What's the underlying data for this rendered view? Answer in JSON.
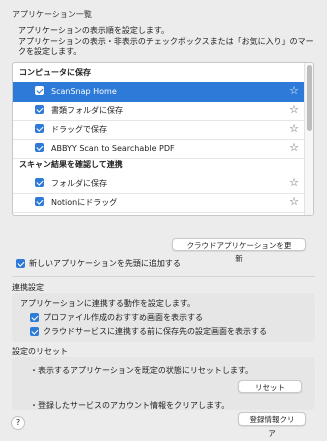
{
  "app_list": {
    "title": "アプリケーション一覧",
    "desc_line1": "アプリケーションの表示順を設定します。",
    "desc_line2": "アプリケーションの表示・非表示のチェックボックスまたは「お気に入り」のマー",
    "desc_line3": "クを設定します。",
    "groups": [
      {
        "header": "コンピュータに保存",
        "items": [
          {
            "label": "ScanSnap Home",
            "checked": true,
            "selected": true
          },
          {
            "label": "書類フォルダに保存",
            "checked": true,
            "selected": false
          },
          {
            "label": "ドラッグで保存",
            "checked": true,
            "selected": false
          },
          {
            "label": "ABBYY Scan to Searchable PDF",
            "checked": true,
            "selected": false
          }
        ]
      },
      {
        "header": "スキャン結果を確認して連携",
        "items": [
          {
            "label": "フォルダに保存",
            "checked": true,
            "selected": false
          },
          {
            "label": "Notionにドラッグ",
            "checked": true,
            "selected": false
          }
        ]
      }
    ],
    "favorite_icon": "star-outline-icon",
    "update_button": "クラウドアプリケーションを更新",
    "add_new_checkbox": "新しいアプリケーションを先頭に追加する"
  },
  "linkage": {
    "title": "連携設定",
    "desc": "アプリケーションに連携する動作を設定します。",
    "option1": "プロファイル作成のおすすめ画面を表示する",
    "option2": "クラウドサービスに連携する前に保存先の設定画面を表示する"
  },
  "reset": {
    "title": "設定のリセット",
    "desc1": "・表示するアプリケーションを既定の状態にリセットします。",
    "reset_button": "リセット",
    "desc2": "・登録したサービスのアカウント情報をクリアします。",
    "clear_button": "登録情報クリア"
  },
  "help_label": "?",
  "colors": {
    "accent": "#2d7ad8",
    "background": "#ececec"
  }
}
